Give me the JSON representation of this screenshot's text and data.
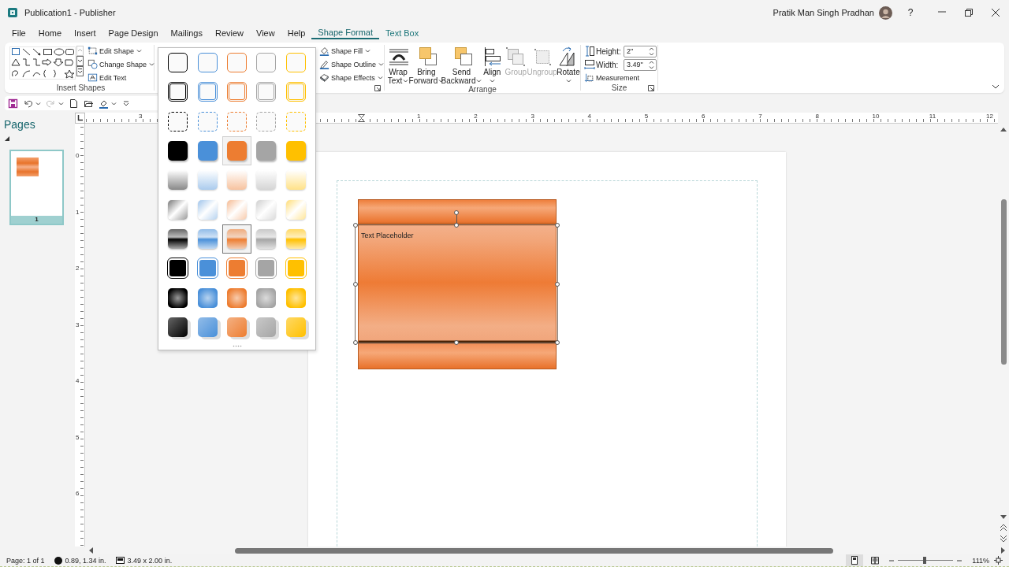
{
  "window": {
    "title": "Publication1 - Publisher",
    "user": "Pratik Man Singh Pradhan",
    "help": "?"
  },
  "tabs": [
    {
      "label": "File",
      "selected": false,
      "contextual": false
    },
    {
      "label": "Home",
      "selected": false,
      "contextual": false
    },
    {
      "label": "Insert",
      "selected": false,
      "contextual": false
    },
    {
      "label": "Page Design",
      "selected": false,
      "contextual": false
    },
    {
      "label": "Mailings",
      "selected": false,
      "contextual": false
    },
    {
      "label": "Review",
      "selected": false,
      "contextual": false
    },
    {
      "label": "View",
      "selected": false,
      "contextual": false
    },
    {
      "label": "Help",
      "selected": false,
      "contextual": false
    },
    {
      "label": "Shape Format",
      "selected": true,
      "contextual": true
    },
    {
      "label": "Text Box",
      "selected": false,
      "contextual": true
    }
  ],
  "ribbon": {
    "groups": [
      {
        "kind": "shapes",
        "label": "Insert Shapes",
        "launcher": false,
        "commands": [
          {
            "label": "Edit Shape",
            "dropdown": true
          },
          {
            "label": "Change Shape",
            "dropdown": true
          },
          {
            "label": "Edit Text",
            "dropdown": false
          }
        ]
      },
      {
        "kind": "styles",
        "launcher": true,
        "commands": [
          {
            "label": "Shape Fill",
            "dropdown": true
          },
          {
            "label": "Shape Outline",
            "dropdown": true
          },
          {
            "label": "Shape Effects",
            "dropdown": true
          }
        ]
      },
      {
        "kind": "large",
        "label": "Arrange",
        "launcher": false,
        "commands": [
          {
            "lines": [
              "Wrap",
              "Text"
            ],
            "dropdown": true,
            "disabled": false
          },
          {
            "lines": [
              "Bring",
              "Forward"
            ],
            "dropdown": true,
            "disabled": false
          },
          {
            "lines": [
              "Send",
              "Backward"
            ],
            "dropdown": true,
            "disabled": false
          },
          {
            "lines": [
              "Align"
            ],
            "dropdown": true,
            "disabled": false
          },
          {
            "lines": [
              "Group"
            ],
            "dropdown": false,
            "disabled": true
          },
          {
            "lines": [
              "Ungroup"
            ],
            "dropdown": false,
            "disabled": true
          },
          {
            "lines": [
              "Rotate"
            ],
            "dropdown": true,
            "disabled": false
          }
        ]
      },
      {
        "kind": "size",
        "label": "Size",
        "launcher": true,
        "fields": [
          {
            "label": "Height:",
            "value": "2\""
          },
          {
            "label": "Width:",
            "value": "3.49\""
          }
        ],
        "commands": [
          {
            "label": "Measurement",
            "dropdown": false
          }
        ]
      }
    ]
  },
  "gallery": {
    "columns": [
      {
        "color": "#000000"
      },
      {
        "color": "#4a90d9"
      },
      {
        "color": "#ed7d31"
      },
      {
        "color": "#a5a5a5"
      },
      {
        "color": "#ffc000"
      }
    ],
    "rows": [
      {
        "kind": "outline",
        "cells": [
          {
            "hovered": false,
            "selected": false
          },
          {
            "hovered": false,
            "selected": false
          },
          {
            "hovered": false,
            "selected": false
          },
          {
            "hovered": false,
            "selected": false
          },
          {
            "hovered": false,
            "selected": false
          }
        ]
      },
      {
        "kind": "double",
        "cells": [
          {
            "hovered": false,
            "selected": false
          },
          {
            "hovered": false,
            "selected": false
          },
          {
            "hovered": false,
            "selected": false
          },
          {
            "hovered": false,
            "selected": false
          },
          {
            "hovered": false,
            "selected": false
          }
        ]
      },
      {
        "kind": "dashed",
        "cells": [
          {
            "hovered": false,
            "selected": false
          },
          {
            "hovered": false,
            "selected": false
          },
          {
            "hovered": false,
            "selected": false
          },
          {
            "hovered": false,
            "selected": false
          },
          {
            "hovered": false,
            "selected": false
          }
        ]
      },
      {
        "kind": "solid",
        "cells": [
          {
            "hovered": false,
            "selected": false
          },
          {
            "hovered": false,
            "selected": false
          },
          {
            "hovered": true,
            "selected": false
          },
          {
            "hovered": false,
            "selected": false
          },
          {
            "hovered": false,
            "selected": false
          }
        ]
      },
      {
        "kind": "fade",
        "cells": [
          {
            "hovered": false,
            "selected": false
          },
          {
            "hovered": false,
            "selected": false
          },
          {
            "hovered": false,
            "selected": false
          },
          {
            "hovered": false,
            "selected": false
          },
          {
            "hovered": false,
            "selected": false
          }
        ]
      },
      {
        "kind": "diagonal",
        "cells": [
          {
            "hovered": false,
            "selected": false
          },
          {
            "hovered": false,
            "selected": false
          },
          {
            "hovered": false,
            "selected": false
          },
          {
            "hovered": false,
            "selected": false
          },
          {
            "hovered": false,
            "selected": false
          }
        ]
      },
      {
        "kind": "glossy",
        "cells": [
          {
            "hovered": false,
            "selected": false
          },
          {
            "hovered": false,
            "selected": false
          },
          {
            "hovered": false,
            "selected": true
          },
          {
            "hovered": false,
            "selected": false
          },
          {
            "hovered": false,
            "selected": false
          }
        ]
      },
      {
        "kind": "framed",
        "cells": [
          {
            "hovered": false,
            "selected": false
          },
          {
            "hovered": false,
            "selected": false
          },
          {
            "hovered": false,
            "selected": false
          },
          {
            "hovered": false,
            "selected": false
          },
          {
            "hovered": false,
            "selected": false
          }
        ]
      },
      {
        "kind": "radial",
        "cells": [
          {
            "hovered": false,
            "selected": false
          },
          {
            "hovered": false,
            "selected": false
          },
          {
            "hovered": false,
            "selected": false
          },
          {
            "hovered": false,
            "selected": false
          },
          {
            "hovered": false,
            "selected": false
          }
        ]
      },
      {
        "kind": "shadow",
        "cells": [
          {
            "hovered": false,
            "selected": false
          },
          {
            "hovered": false,
            "selected": false
          },
          {
            "hovered": false,
            "selected": false
          },
          {
            "hovered": false,
            "selected": false
          },
          {
            "hovered": false,
            "selected": false
          }
        ]
      }
    ]
  },
  "pages_pane": {
    "title": "Pages",
    "pages": [
      {
        "number": "1",
        "selected": true
      }
    ]
  },
  "rulers": {
    "horizontal": [
      "3",
      "1",
      "2",
      "3",
      "4",
      "5",
      "6",
      "7",
      "8",
      "10",
      "11",
      "12"
    ],
    "vertical": [
      "0",
      "1",
      "2",
      "3",
      "4",
      "5",
      "6"
    ]
  },
  "document": {
    "shape": {
      "text": "Text Placeholder",
      "selected": true
    }
  },
  "status_bar": {
    "page": "Page: 1 of 1",
    "position": "0.89, 1.34 in.",
    "size": "3.49 x 2.00 in.",
    "views": [
      {
        "selected": true
      },
      {
        "selected": false
      }
    ],
    "zoom_slider": {
      "level": 0.48
    },
    "zoom": "111%"
  }
}
